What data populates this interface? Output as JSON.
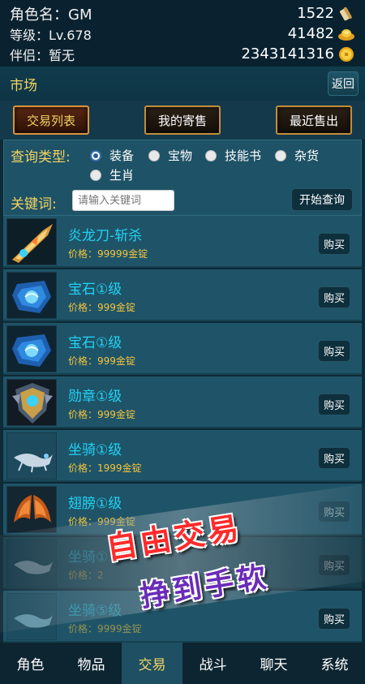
{
  "header": {
    "role_name": "角色名：GM",
    "level": "等级：Lv.678",
    "partner": "伴侣：暂无",
    "currency1": "1522",
    "currency2": "41482",
    "currency3": "2343141316",
    "currency1_icon": "scroll-icon",
    "currency2_icon": "gold-ingot-icon",
    "currency3_icon": "gold-coin-icon"
  },
  "market": {
    "title": "市场",
    "back_label": "返回"
  },
  "tabs": [
    {
      "label": "交易列表",
      "active": true
    },
    {
      "label": "我的寄售",
      "active": false
    },
    {
      "label": "最近售出",
      "active": false
    }
  ],
  "filter": {
    "query_type_label": "查询类型:",
    "types": [
      {
        "label": "装备",
        "checked": true
      },
      {
        "label": "宝物",
        "checked": false
      },
      {
        "label": "技能书",
        "checked": false
      },
      {
        "label": "杂货",
        "checked": false
      },
      {
        "label": "生肖",
        "checked": false
      }
    ],
    "keyword_label": "关键词:",
    "keyword_placeholder": "请输入关键词",
    "keyword_value": "",
    "query_button": "开始查询"
  },
  "items": [
    {
      "name": "炎龙刀-斩杀",
      "price": "价格：99999金锭",
      "buy": "购买",
      "icon": "blade-icon"
    },
    {
      "name": "宝石①级",
      "price": "价格：999金锭",
      "buy": "购买",
      "icon": "gem-icon"
    },
    {
      "name": "宝石①级",
      "price": "价格：999金锭",
      "buy": "购买",
      "icon": "gem-icon"
    },
    {
      "name": "勋章①级",
      "price": "价格：999金锭",
      "buy": "购买",
      "icon": "medal-icon"
    },
    {
      "name": "坐骑①级",
      "price": "价格：1999金锭",
      "buy": "购买",
      "icon": "mount-icon"
    },
    {
      "name": "翅膀①级",
      "price": "价格：999金锭",
      "buy": "购买",
      "icon": "wings-icon"
    },
    {
      "name": "坐骑①",
      "price": "价格：2",
      "buy": "购买",
      "icon": "mount-icon"
    },
    {
      "name": "坐骑⑤级",
      "price": "价格：9999金锭",
      "buy": "购买",
      "icon": "mount-icon"
    }
  ],
  "promo": {
    "line1": "自由交易",
    "line2": "挣到手软"
  },
  "bottom_nav": [
    {
      "label": "角色",
      "active": false
    },
    {
      "label": "物品",
      "active": false
    },
    {
      "label": "交易",
      "active": true
    },
    {
      "label": "战斗",
      "active": false
    },
    {
      "label": "聊天",
      "active": false
    },
    {
      "label": "系统",
      "active": false
    }
  ]
}
